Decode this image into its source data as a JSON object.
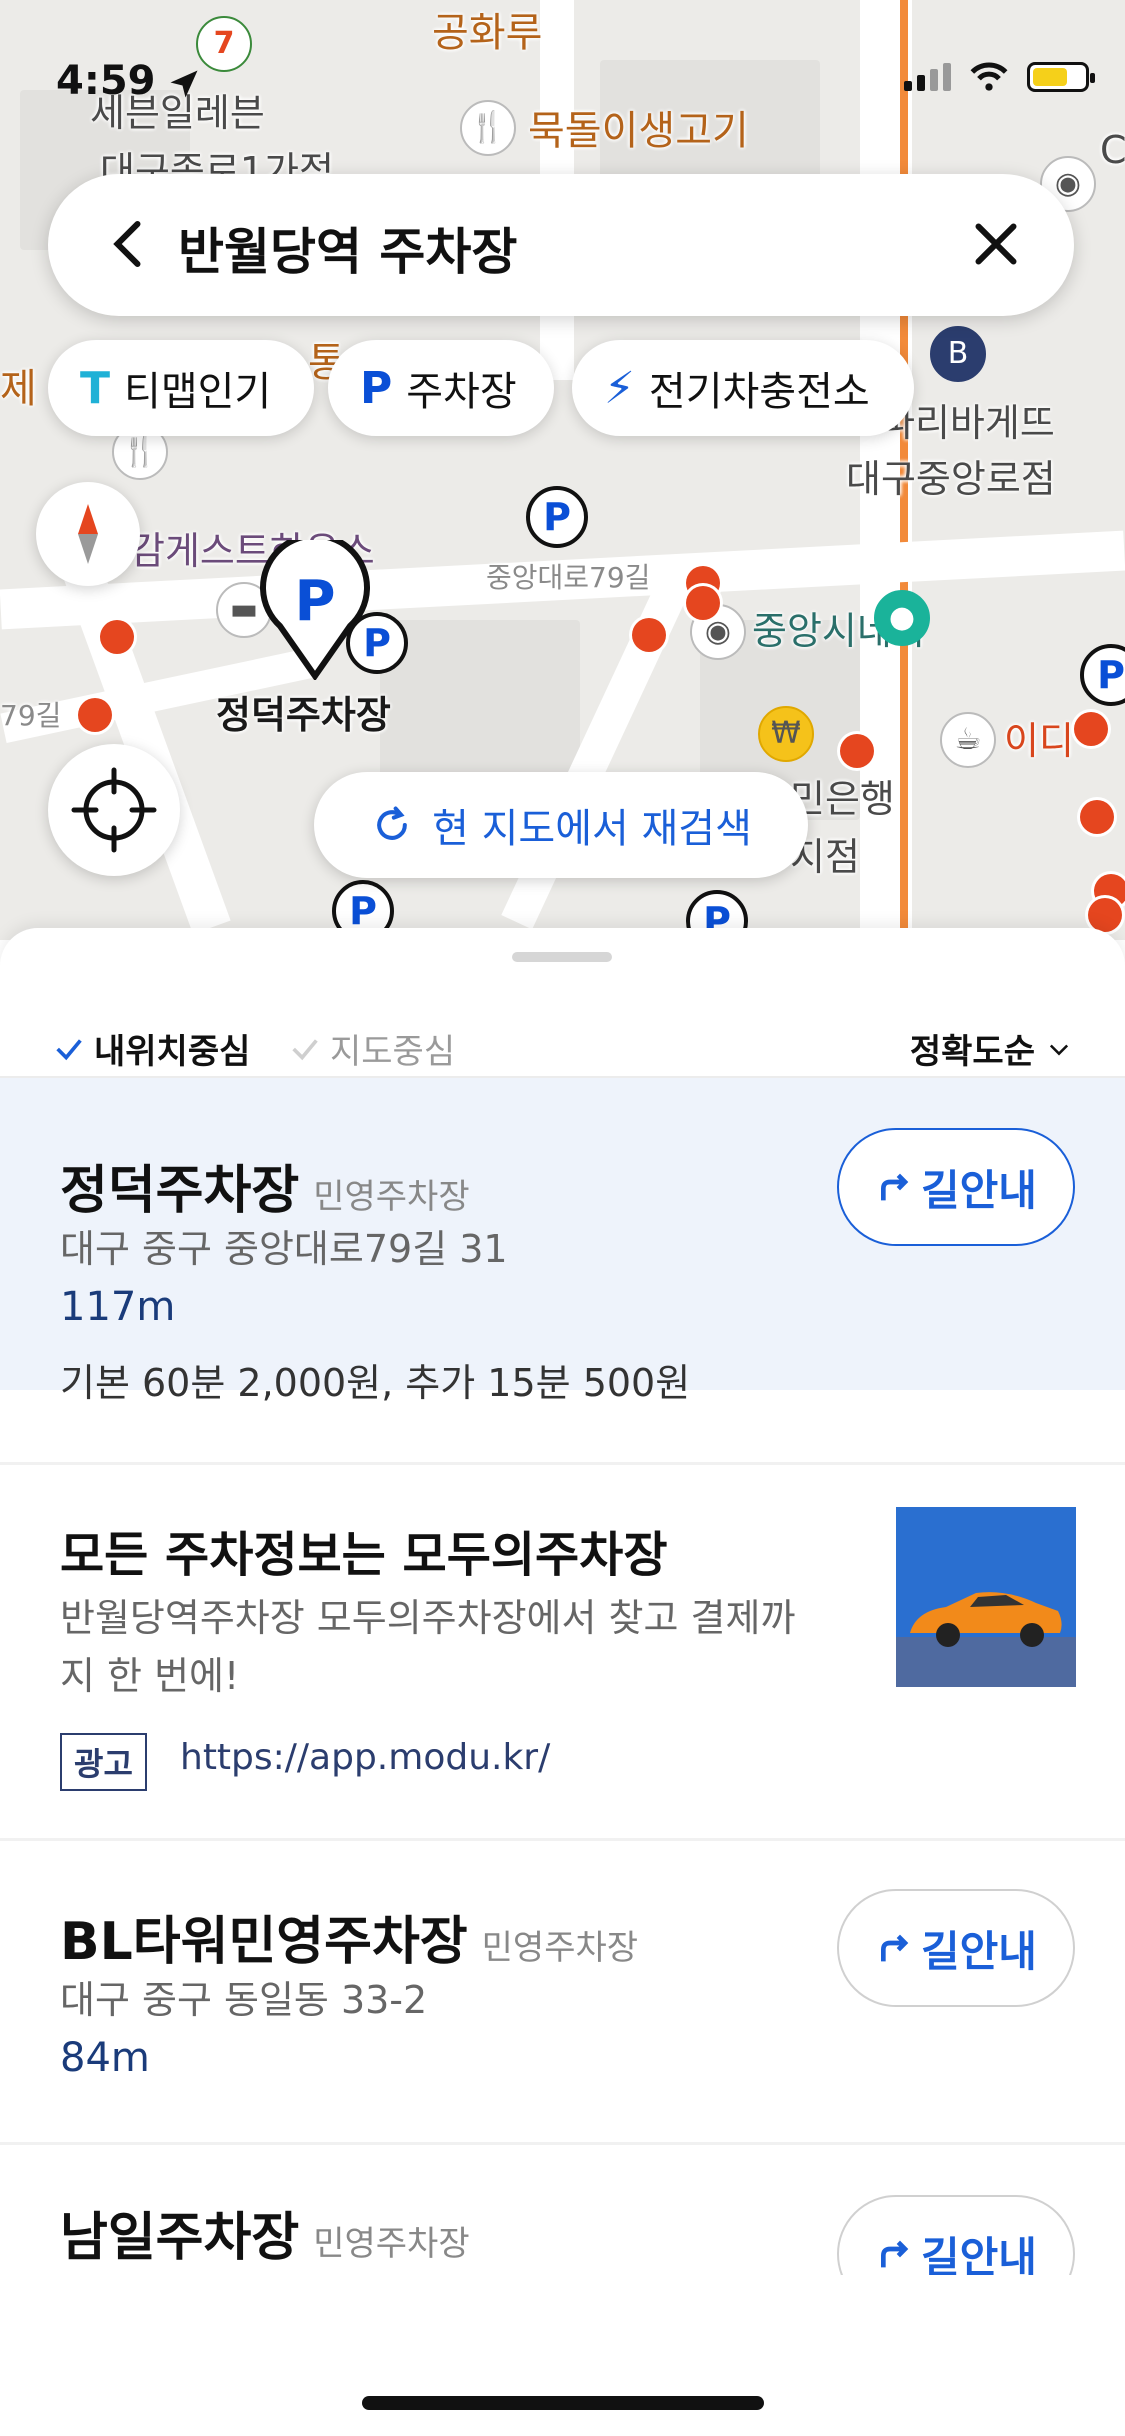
{
  "status_bar": {
    "time": "4:59"
  },
  "map": {
    "labels": {
      "seven_eleven": "세븐일레븐",
      "seven_eleven_branch": "대구종로1가점",
      "gonghwaru": "공화루",
      "mokdol": "묵돌이생고기",
      "paris": "파리바게뜨",
      "paris_branch": "대구중앙로점",
      "guesthouse": "감게스트하우스",
      "road": "중앙대로79길",
      "road_left": "79길",
      "cinema": "중앙시네마",
      "bank_a": "민은행",
      "bank_b": "지점",
      "cafe": "이디",
      "selected_parking": "정덕주차장",
      "partial_left": "제",
      "partial_top": "통",
      "partial_c": "C"
    }
  },
  "search": {
    "query": "반월당역 주차장"
  },
  "chips": [
    {
      "icon": "T",
      "label": "티맵인기"
    },
    {
      "icon": "P",
      "label": "주차장"
    },
    {
      "icon": "⚡",
      "label": "전기차충전소"
    }
  ],
  "research_button": {
    "label": "현 지도에서 재검색"
  },
  "filters": {
    "my_location": "내위치중심",
    "map_center": "지도중심",
    "sort": "정확도순"
  },
  "results": [
    {
      "name": "정덕주차장",
      "category": "민영주차장",
      "address": "대구 중구 중앙대로79길 31",
      "distance": "117m",
      "price": "기본 60분 2,000원, 추가 15분 500원",
      "nav_label": "길안내"
    },
    {
      "name": "BL타워민영주차장",
      "category": "민영주차장",
      "address": "대구 중구 동일동 33-2",
      "distance": "84m",
      "nav_label": "길안내"
    },
    {
      "name": "남일주차장",
      "category": "민영주차장",
      "nav_label": "길안내"
    }
  ],
  "ad": {
    "title": "모든 주차정보는 모두의주차장",
    "body_line1": "반월당역주차장 모두의주차장에서 찾고 결제까",
    "body_line2": "지 한 번에!",
    "badge": "광고",
    "url": "https://app.modu.kr/"
  },
  "colors": {
    "accent_blue": "#1a5fd8",
    "selected_bg": "#eef3fb",
    "map_red_pin": "#e5461f"
  }
}
